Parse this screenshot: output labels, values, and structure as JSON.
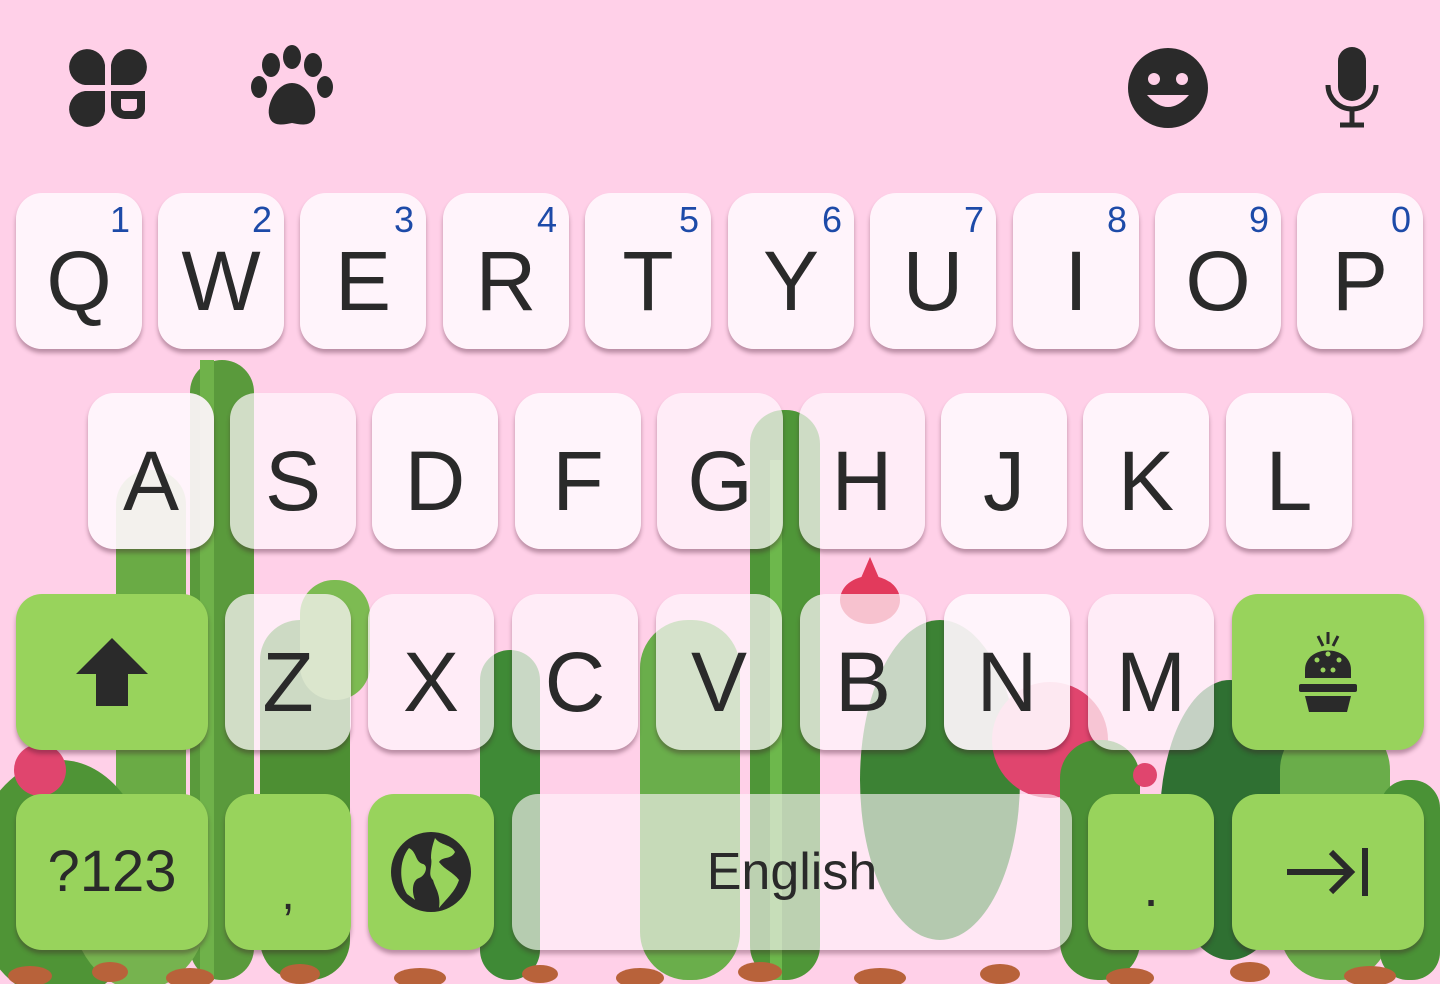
{
  "toolbar": {
    "left_icons": [
      "clover-icon",
      "paw-icon"
    ],
    "right_icons": [
      "emoji-icon",
      "microphone-icon"
    ]
  },
  "keyboard": {
    "row1": [
      {
        "label": "Q",
        "hint": "1"
      },
      {
        "label": "W",
        "hint": "2"
      },
      {
        "label": "E",
        "hint": "3"
      },
      {
        "label": "R",
        "hint": "4"
      },
      {
        "label": "T",
        "hint": "5"
      },
      {
        "label": "Y",
        "hint": "6"
      },
      {
        "label": "U",
        "hint": "7"
      },
      {
        "label": "I",
        "hint": "8"
      },
      {
        "label": "O",
        "hint": "9"
      },
      {
        "label": "P",
        "hint": "0"
      }
    ],
    "row2": [
      "A",
      "S",
      "D",
      "F",
      "G",
      "H",
      "J",
      "K",
      "L"
    ],
    "row3": [
      "Z",
      "X",
      "C",
      "V",
      "B",
      "N",
      "M"
    ],
    "shift_icon": "shift-arrow-icon",
    "theme_icon": "cactus-pot-icon",
    "symbols_label": "?123",
    "comma_label": ",",
    "globe_icon": "globe-icon",
    "space_label": "English",
    "period_label": ".",
    "enter_icon": "tab-arrow-icon"
  },
  "colors": {
    "background": "#ffd0e8",
    "function_key": "#98d35c",
    "letter_key": "#fff6fc",
    "hint": "#1d4aa8",
    "icon": "#2a2a2a"
  }
}
